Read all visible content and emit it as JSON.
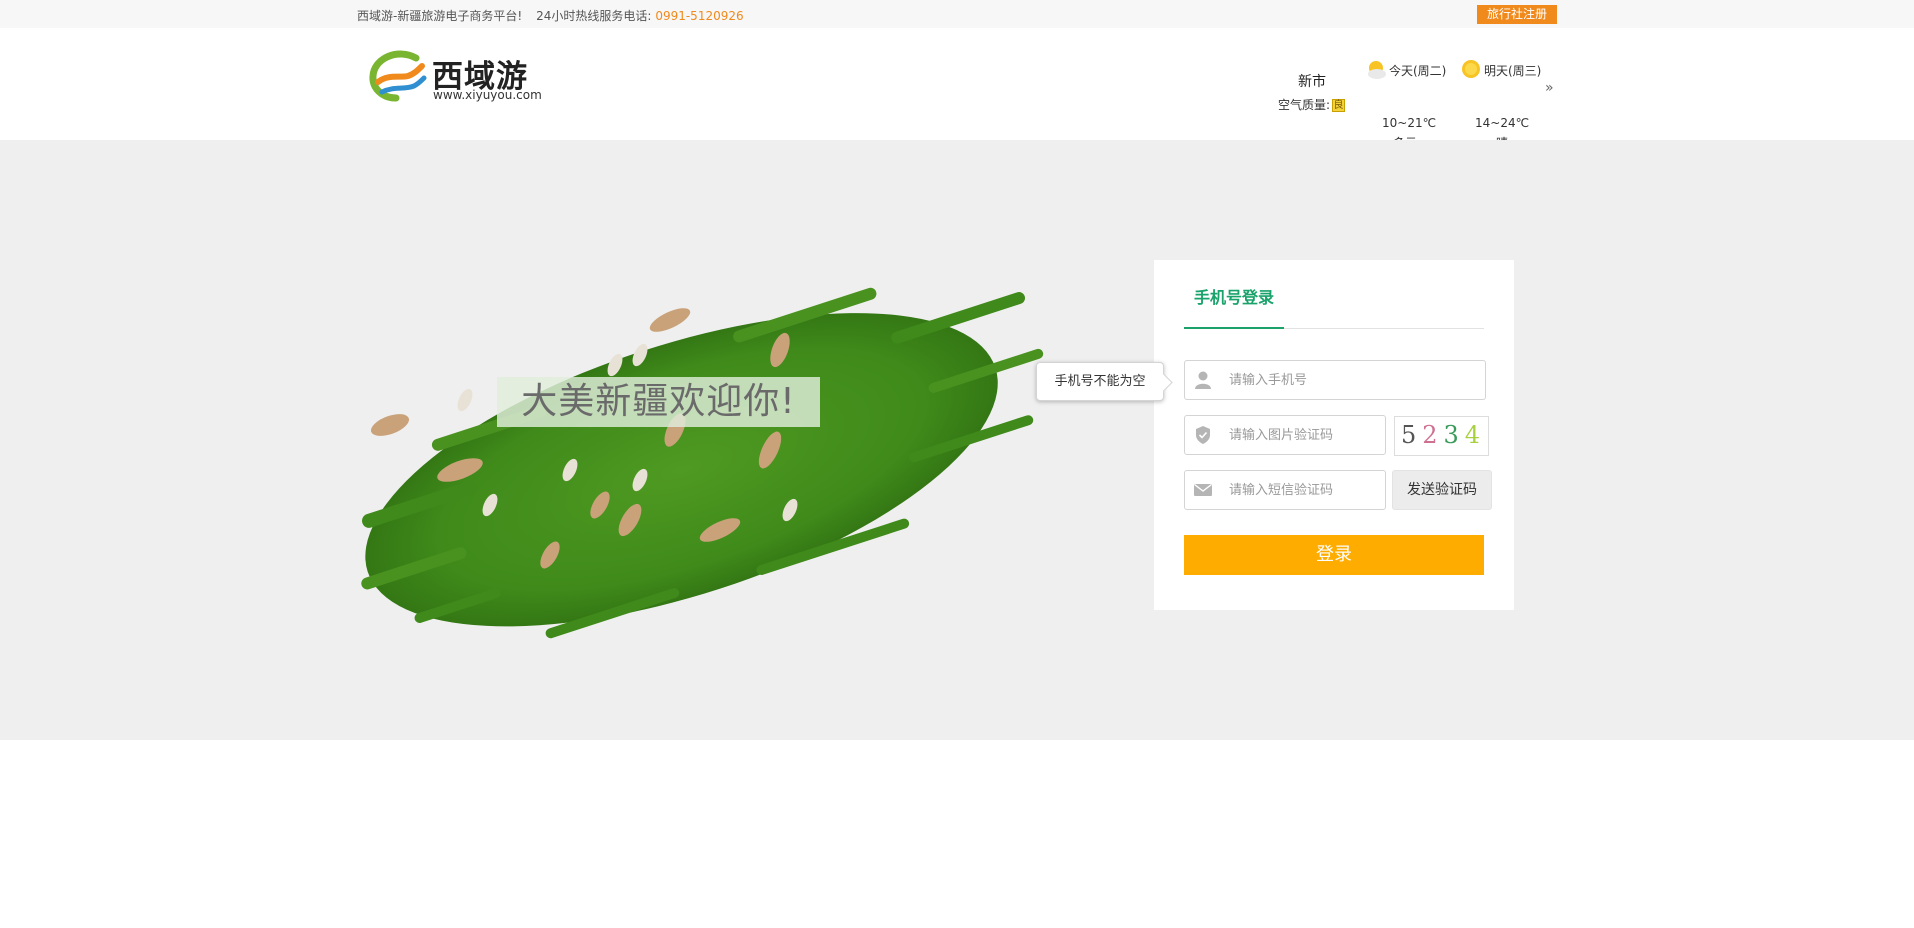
{
  "topbar": {
    "slogan": "西域游-新疆旅游电子商务平台!",
    "hotline_label": "24小时热线服务电话:",
    "hotline_number": "0991-5120926",
    "agency_register": "旅行社注册"
  },
  "logo": {
    "name": "西域游",
    "url_text": "www.xiyuyou.com"
  },
  "weather": {
    "city": "新市",
    "air_quality_label": "空气质量:",
    "air_quality_value": "良",
    "today": {
      "label": "今天(周二)",
      "temp": "10~21℃",
      "condition": "多云",
      "icon": "partly-sunny-icon"
    },
    "tomorrow": {
      "label": "明天(周三)",
      "temp": "14~24℃",
      "condition": "晴",
      "icon": "sun-icon"
    },
    "more_icon": "double-chevron-right-icon"
  },
  "banner": {
    "welcome_text": "大美新疆欢迎你!"
  },
  "login": {
    "tab_label": "手机号登录",
    "phone_placeholder": "请输入手机号",
    "phone_value": "",
    "phone_error": "手机号不能为空",
    "image_code_placeholder": "请输入图片验证码",
    "image_code_value": "",
    "captcha_text": "5234",
    "sms_code_placeholder": "请输入短信验证码",
    "sms_code_value": "",
    "send_code_label": "发送验证码",
    "submit_label": "登录"
  },
  "colors": {
    "accent_orange": "#f08a1c",
    "login_button": "#ffac00",
    "tab_green": "#19a36b",
    "banner_bg": "#efefef"
  }
}
